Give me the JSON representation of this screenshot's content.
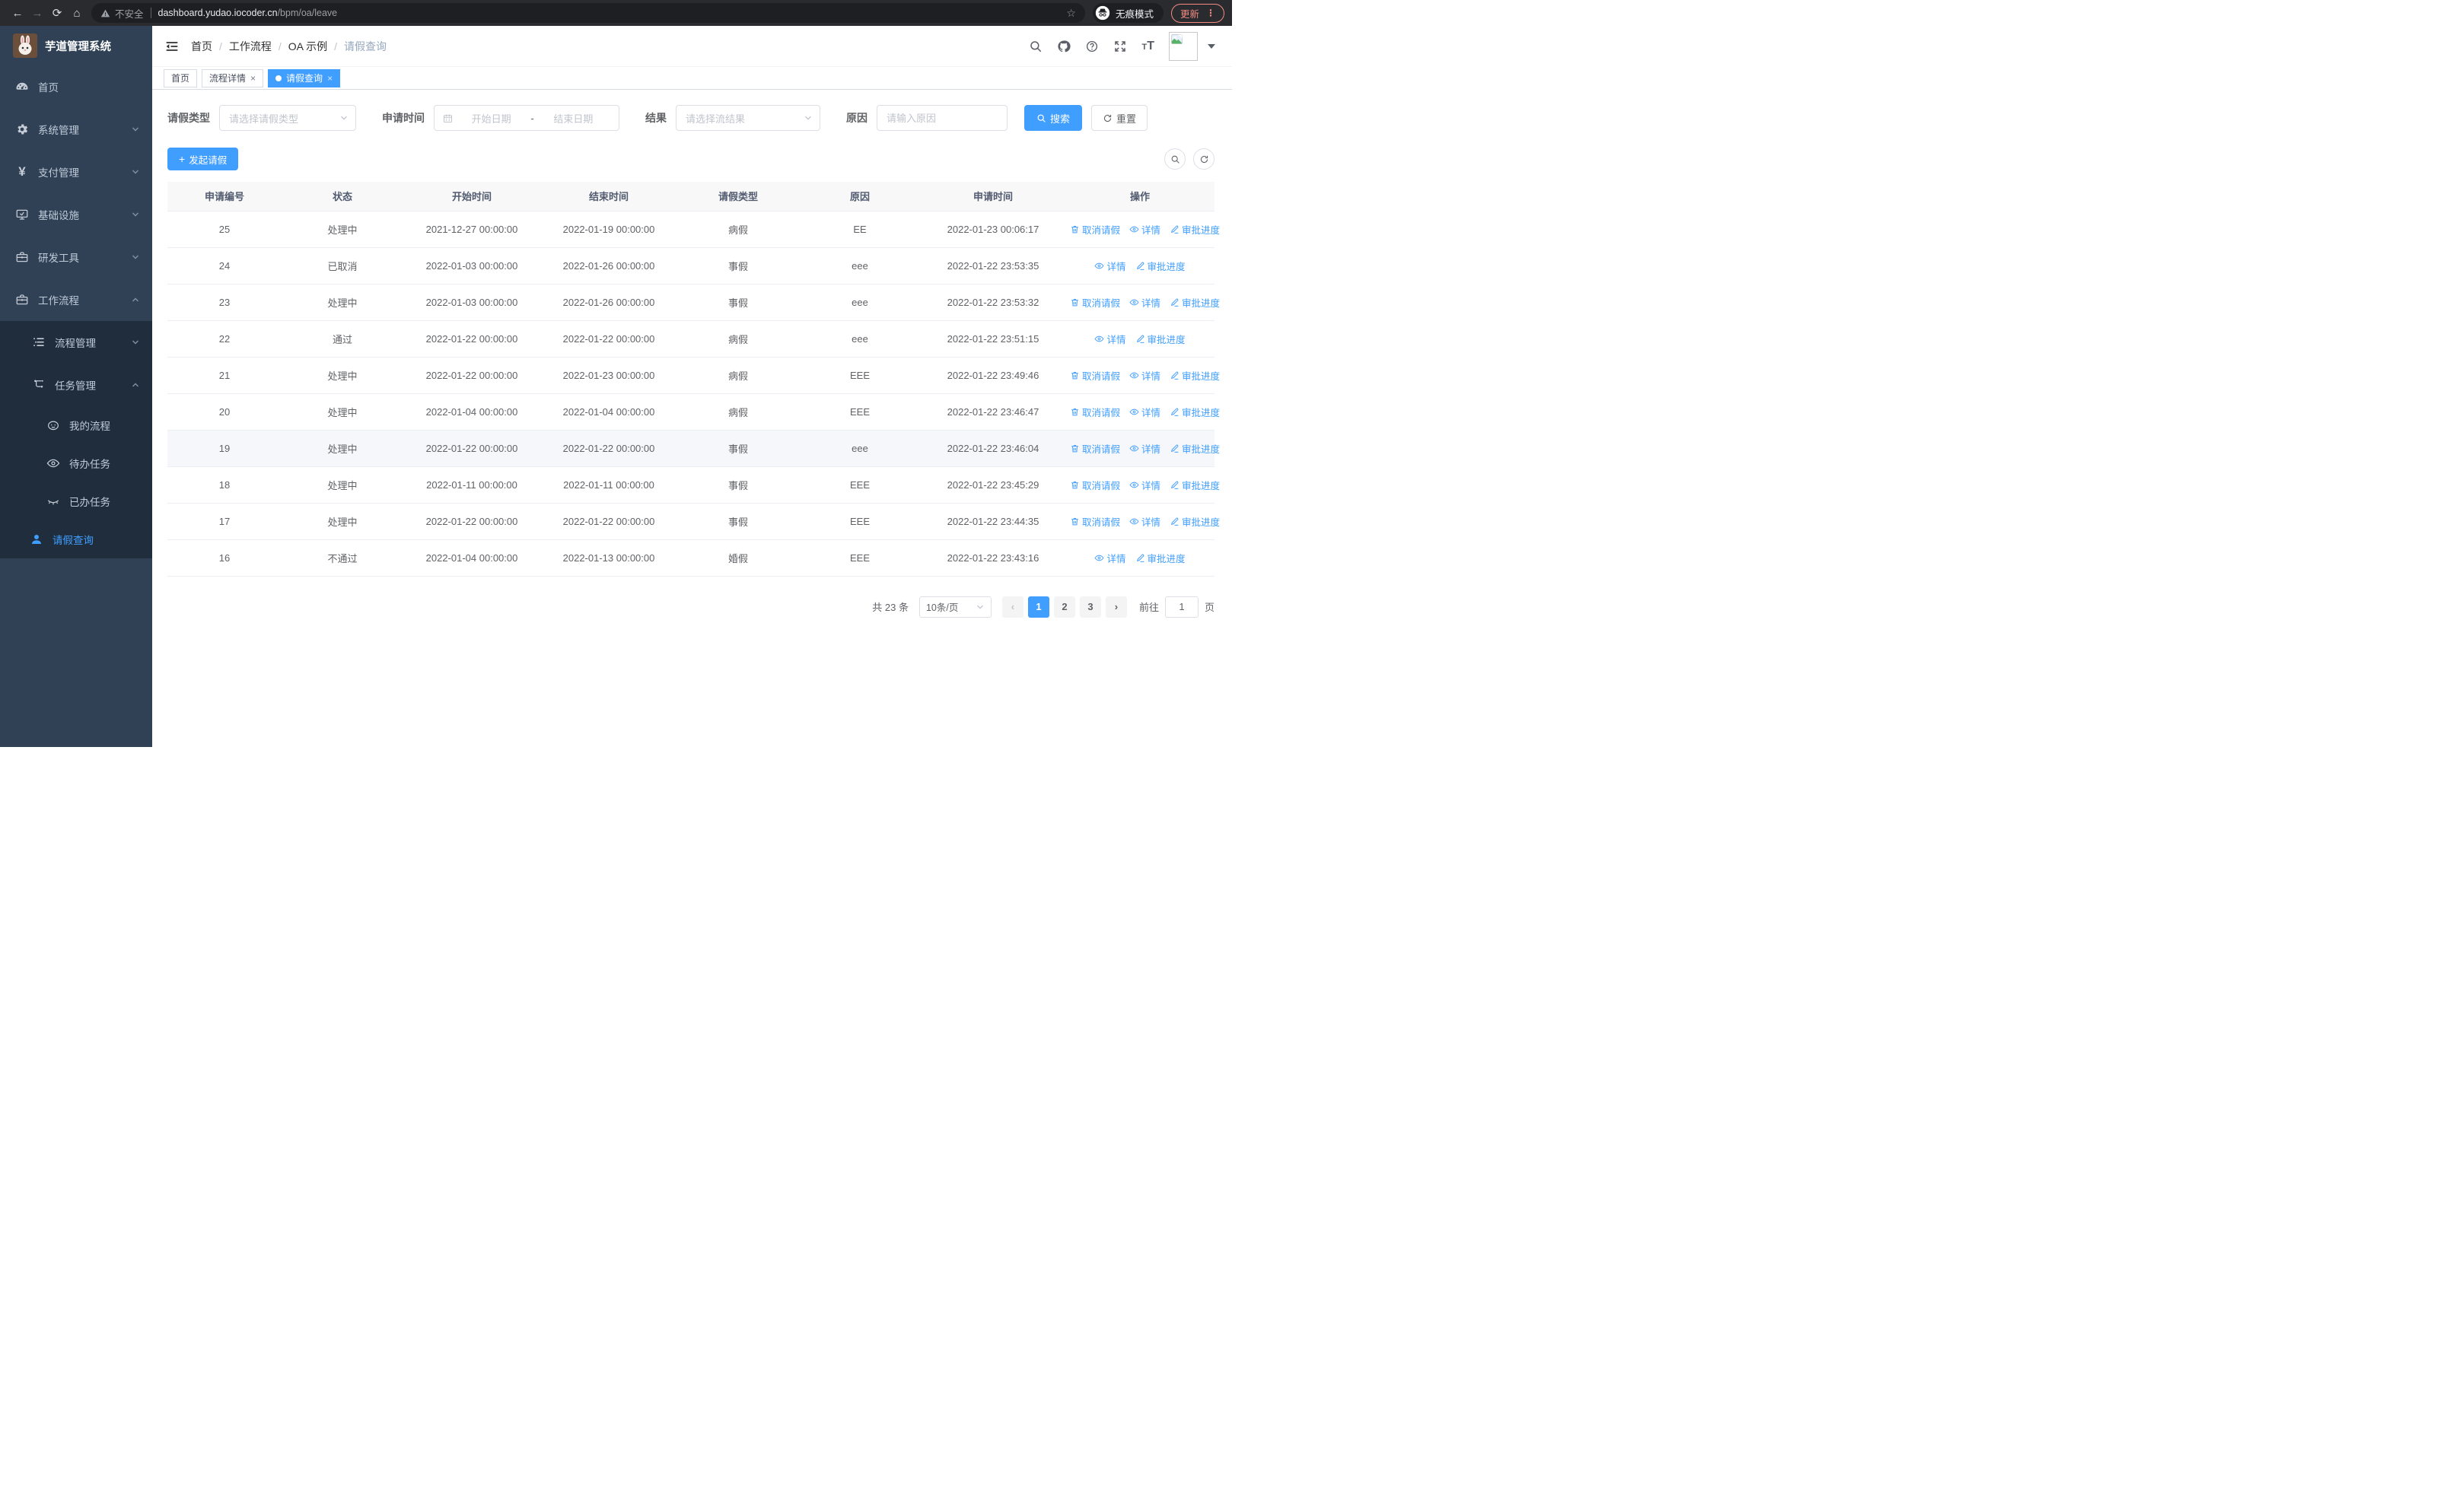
{
  "browser": {
    "security_label": "不安全",
    "url_host": "dashboard.yudao.iocoder.cn",
    "url_path": "/bpm/oa/leave",
    "incognito_label": "无痕模式",
    "update_label": "更新"
  },
  "sidebar": {
    "logo_title": "芋道管理系统",
    "menu": [
      {
        "name": "home",
        "label": "首页",
        "icon": "dashboard"
      },
      {
        "name": "system",
        "label": "系统管理",
        "icon": "gear",
        "chevron": "down"
      },
      {
        "name": "payment",
        "label": "支付管理",
        "icon": "yen",
        "chevron": "down"
      },
      {
        "name": "infra",
        "label": "基础设施",
        "icon": "monitor",
        "chevron": "down"
      },
      {
        "name": "devtools",
        "label": "研发工具",
        "icon": "toolbox",
        "chevron": "down"
      },
      {
        "name": "workflow",
        "label": "工作流程",
        "icon": "briefcase",
        "chevron": "up"
      }
    ],
    "submenu": [
      {
        "name": "process-mgmt",
        "label": "流程管理",
        "icon": "list-tree",
        "chevron": "down",
        "level": 2
      },
      {
        "name": "task-mgmt",
        "label": "任务管理",
        "icon": "flow",
        "chevron": "up",
        "level": 2
      },
      {
        "name": "my-process",
        "label": "我的流程",
        "icon": "robot-face",
        "level": 3
      },
      {
        "name": "todo-tasks",
        "label": "待办任务",
        "icon": "eye-open",
        "level": 3
      },
      {
        "name": "done-tasks",
        "label": "已办任务",
        "icon": "eye-closed",
        "level": 3
      },
      {
        "name": "leave-query",
        "label": "请假查询",
        "icon": "user",
        "level": 2,
        "active": true
      }
    ]
  },
  "header": {
    "breadcrumb": [
      "首页",
      "工作流程",
      "OA 示例",
      "请假查询"
    ]
  },
  "tabs": [
    {
      "name": "home",
      "label": "首页"
    },
    {
      "name": "process-detail",
      "label": "流程详情",
      "closable": true
    },
    {
      "name": "leave-query",
      "label": "请假查询",
      "closable": true,
      "active": true
    }
  ],
  "filters": {
    "type_label": "请假类型",
    "type_placeholder": "请选择请假类型",
    "time_label": "申请时间",
    "start_placeholder": "开始日期",
    "range_separator": "-",
    "end_placeholder": "结束日期",
    "result_label": "结果",
    "result_placeholder": "请选择流结果",
    "reason_label": "原因",
    "reason_placeholder": "请输入原因",
    "search_label": "搜索",
    "reset_label": "重置"
  },
  "toolbar": {
    "create_label": "发起请假"
  },
  "table": {
    "columns": [
      "申请编号",
      "状态",
      "开始时间",
      "结束时间",
      "请假类型",
      "原因",
      "申请时间",
      "操作"
    ],
    "action_labels": {
      "cancel": "取消请假",
      "detail": "详情",
      "progress": "审批进度"
    },
    "rows": [
      {
        "id": "25",
        "status": "处理中",
        "start": "2021-12-27 00:00:00",
        "end": "2022-01-19 00:00:00",
        "type": "病假",
        "reason": "EE",
        "applied": "2022-01-23 00:06:17",
        "actions": [
          "cancel",
          "detail",
          "progress"
        ]
      },
      {
        "id": "24",
        "status": "已取消",
        "start": "2022-01-03 00:00:00",
        "end": "2022-01-26 00:00:00",
        "type": "事假",
        "reason": "eee",
        "applied": "2022-01-22 23:53:35",
        "actions": [
          "detail",
          "progress"
        ]
      },
      {
        "id": "23",
        "status": "处理中",
        "start": "2022-01-03 00:00:00",
        "end": "2022-01-26 00:00:00",
        "type": "事假",
        "reason": "eee",
        "applied": "2022-01-22 23:53:32",
        "actions": [
          "cancel",
          "detail",
          "progress"
        ]
      },
      {
        "id": "22",
        "status": "通过",
        "start": "2022-01-22 00:00:00",
        "end": "2022-01-22 00:00:00",
        "type": "病假",
        "reason": "eee",
        "applied": "2022-01-22 23:51:15",
        "actions": [
          "detail",
          "progress"
        ]
      },
      {
        "id": "21",
        "status": "处理中",
        "start": "2022-01-22 00:00:00",
        "end": "2022-01-23 00:00:00",
        "type": "病假",
        "reason": "EEE",
        "applied": "2022-01-22 23:49:46",
        "actions": [
          "cancel",
          "detail",
          "progress"
        ]
      },
      {
        "id": "20",
        "status": "处理中",
        "start": "2022-01-04 00:00:00",
        "end": "2022-01-04 00:00:00",
        "type": "病假",
        "reason": "EEE",
        "applied": "2022-01-22 23:46:47",
        "actions": [
          "cancel",
          "detail",
          "progress"
        ]
      },
      {
        "id": "19",
        "status": "处理中",
        "start": "2022-01-22 00:00:00",
        "end": "2022-01-22 00:00:00",
        "type": "事假",
        "reason": "eee",
        "applied": "2022-01-22 23:46:04",
        "actions": [
          "cancel",
          "detail",
          "progress"
        ],
        "highlight": true
      },
      {
        "id": "18",
        "status": "处理中",
        "start": "2022-01-11 00:00:00",
        "end": "2022-01-11 00:00:00",
        "type": "事假",
        "reason": "EEE",
        "applied": "2022-01-22 23:45:29",
        "actions": [
          "cancel",
          "detail",
          "progress"
        ]
      },
      {
        "id": "17",
        "status": "处理中",
        "start": "2022-01-22 00:00:00",
        "end": "2022-01-22 00:00:00",
        "type": "事假",
        "reason": "EEE",
        "applied": "2022-01-22 23:44:35",
        "actions": [
          "cancel",
          "detail",
          "progress"
        ]
      },
      {
        "id": "16",
        "status": "不通过",
        "start": "2022-01-04 00:00:00",
        "end": "2022-01-13 00:00:00",
        "type": "婚假",
        "reason": "EEE",
        "applied": "2022-01-22 23:43:16",
        "actions": [
          "detail",
          "progress"
        ]
      }
    ]
  },
  "pagination": {
    "total_label": "共 23 条",
    "page_size_label": "10条/页",
    "pages": [
      {
        "label": "1",
        "active": true
      },
      {
        "label": "2"
      },
      {
        "label": "3"
      }
    ],
    "goto_label": "前往",
    "goto_value": "1",
    "page_suffix": "页"
  },
  "colors": {
    "accent": "#409eff",
    "sidebar_bg": "#304156",
    "submenu_bg": "#1f2d3d",
    "update_accent": "#f28b82"
  }
}
